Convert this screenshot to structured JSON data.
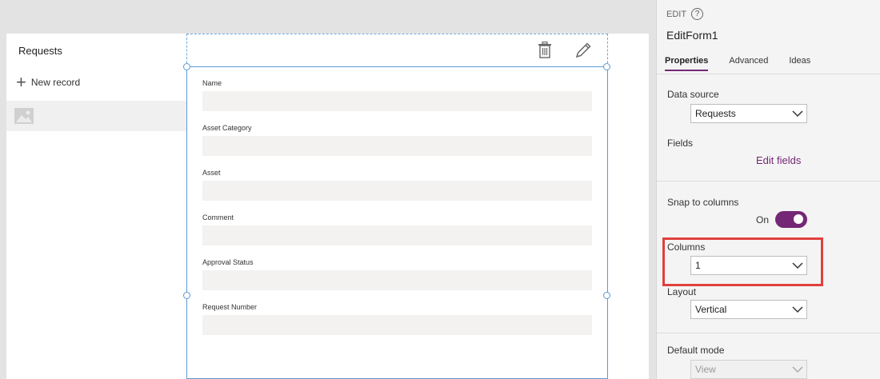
{
  "gallery": {
    "title": "Requests",
    "new_record_label": "New record"
  },
  "form": {
    "fields": [
      {
        "label": "Name"
      },
      {
        "label": "Asset Category"
      },
      {
        "label": "Asset"
      },
      {
        "label": "Comment"
      },
      {
        "label": "Approval Status"
      },
      {
        "label": "Request Number"
      }
    ]
  },
  "panel": {
    "section": "EDIT",
    "control_name": "EditForm1",
    "tabs": [
      "Properties",
      "Advanced",
      "Ideas"
    ],
    "data_source_label": "Data source",
    "data_source_value": "Requests",
    "fields_label": "Fields",
    "edit_fields_link": "Edit fields",
    "snap_label": "Snap to columns",
    "snap_state": "On",
    "columns_label": "Columns",
    "columns_value": "1",
    "layout_label": "Layout",
    "layout_value": "Vertical",
    "default_mode_label": "Default mode",
    "default_mode_value": "View"
  },
  "colors": {
    "accent": "#742774",
    "selection": "#5b9bd5",
    "highlight": "#e0403e"
  }
}
